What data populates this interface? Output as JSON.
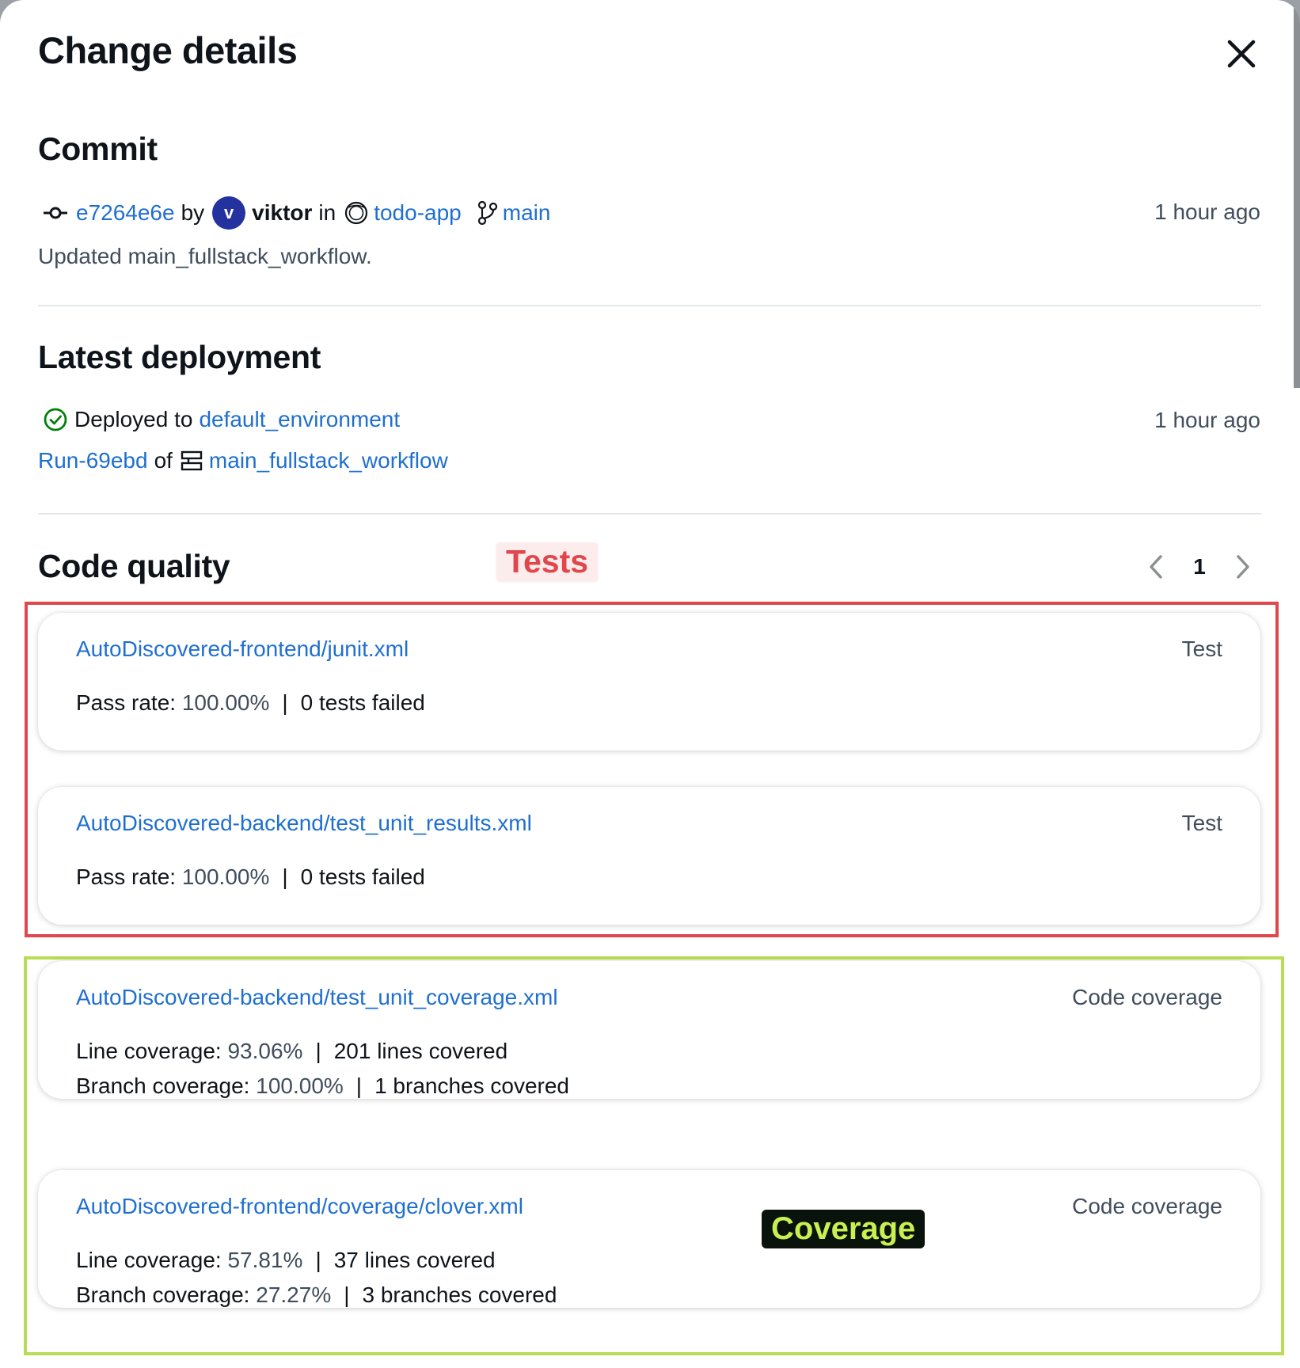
{
  "header": {
    "title": "Change details"
  },
  "commit": {
    "section_title": "Commit",
    "commit_id": "e7264e6e",
    "by": "by",
    "avatar_initial": "v",
    "author": "viktor",
    "in": "in",
    "repo": "todo-app",
    "branch": "main",
    "time": "1 hour ago",
    "message": "Updated main_fullstack_workflow."
  },
  "deployment": {
    "section_title": "Latest deployment",
    "deployed_to": "Deployed to",
    "environment": "default_environment",
    "time": "1 hour ago",
    "run": "Run-69ebd",
    "of": "of",
    "workflow": "main_fullstack_workflow"
  },
  "code_quality": {
    "section_title": "Code quality",
    "page": "1",
    "cards": [
      {
        "title": "AutoDiscovered-frontend/junit.xml",
        "type": "Test",
        "lines": [
          {
            "label": "Pass rate: ",
            "value": "100.00%",
            "sep": "|",
            "detail": "0 tests failed"
          }
        ]
      },
      {
        "title": "AutoDiscovered-backend/test_unit_results.xml",
        "type": "Test",
        "lines": [
          {
            "label": "Pass rate: ",
            "value": "100.00%",
            "sep": "|",
            "detail": "0 tests failed"
          }
        ]
      },
      {
        "title": "AutoDiscovered-backend/test_unit_coverage.xml",
        "type": "Code coverage",
        "lines": [
          {
            "label": "Line coverage: ",
            "value": "93.06%",
            "sep": "|",
            "detail": "201 lines covered"
          },
          {
            "label": "Branch coverage: ",
            "value": "100.00%",
            "sep": "|",
            "detail": "1 branches covered"
          }
        ]
      },
      {
        "title": "AutoDiscovered-frontend/coverage/clover.xml",
        "type": "Code coverage",
        "lines": [
          {
            "label": "Line coverage: ",
            "value": "57.81%",
            "sep": "|",
            "detail": "37 lines covered"
          },
          {
            "label": "Branch coverage: ",
            "value": "27.27%",
            "sep": "|",
            "detail": "3 branches covered"
          }
        ]
      }
    ]
  },
  "annotations": {
    "tests_label": "Tests",
    "coverage_label": "Coverage"
  },
  "colors": {
    "link": "#1f6fd1",
    "tests_box": "#e0474c",
    "coverage_box": "#b9dd52",
    "success": "#037f0c",
    "avatar": "#23329e"
  },
  "icons": {
    "close": "close-icon",
    "commit": "commit-icon",
    "repo": "repository-icon",
    "branch": "branch-icon",
    "success": "check-circle-icon",
    "workflow": "workflow-icon",
    "prev": "chevron-left-icon",
    "next": "chevron-right-icon"
  }
}
